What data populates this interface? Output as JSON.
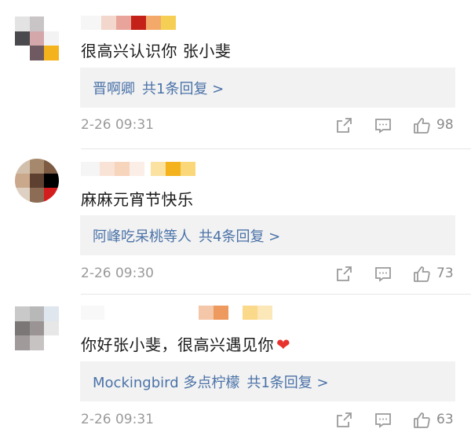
{
  "comments": [
    {
      "text": "很高兴认识你 张小斐",
      "reply_names": "晋啊卿",
      "reply_count": "共1条回复 >",
      "date": "2-26 09:31",
      "likes": "98"
    },
    {
      "text": "麻麻元宵节快乐",
      "reply_names": "阿峰吃呆桃等人",
      "reply_count": "共4条回复 >",
      "date": "2-26 09:30",
      "likes": "73"
    },
    {
      "text": "你好张小斐，很高兴遇见你",
      "reply_names": "Mockingbird 多点柠檬",
      "reply_count": "共1条回复 >",
      "date": "2-26 09:31",
      "likes": "63"
    }
  ],
  "colors": {
    "link": "#4a72a8",
    "meta": "#9a9a9a",
    "heart": "#e8322e",
    "reply_bg": "#f2f2f2"
  },
  "icons": [
    "forward-icon",
    "comment-icon",
    "thumbs-up-icon",
    "heart-icon"
  ]
}
